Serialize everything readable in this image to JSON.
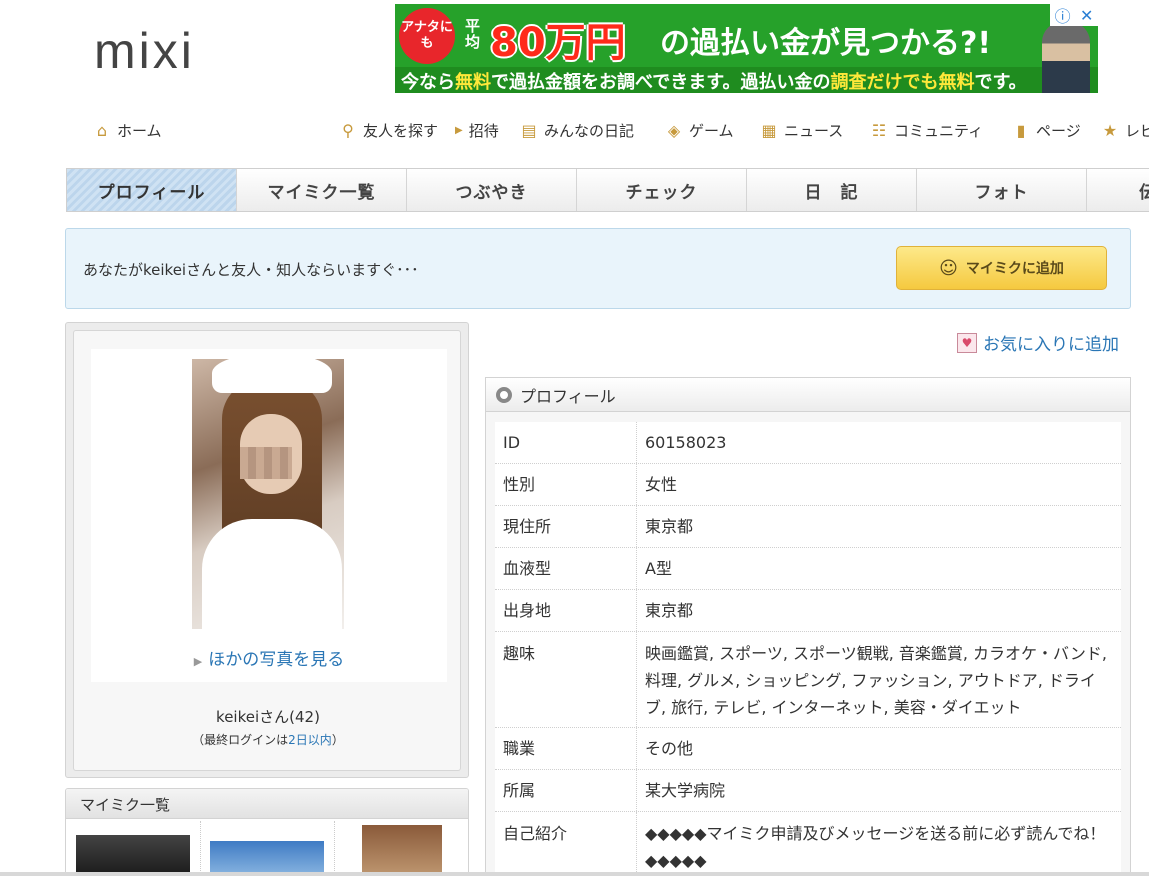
{
  "header": {
    "logo": "mixi"
  },
  "ad": {
    "badge": "アナタにも",
    "avg": "平均",
    "big": "80万円",
    "rest": "の過払い金が見つかる?!",
    "sub_a": "今なら",
    "sub_b": "無料",
    "sub_c": "で過払金額をお調べできます。過払い金の",
    "sub_d": "調査だけでも無料",
    "sub_e": "です。",
    "info_icon": "ⓘ",
    "close_icon": "✕"
  },
  "gnav": {
    "home": "ホーム",
    "find": "友人を探す",
    "invite": "招待",
    "diary": "みんなの日記",
    "game": "ゲーム",
    "news": "ニュース",
    "community": "コミュニティ",
    "page": "ページ",
    "review": "レビ"
  },
  "tabs": [
    "プロフィール",
    "マイミク一覧",
    "つぶやき",
    "チェック",
    "日　記",
    "フォト",
    "伝"
  ],
  "notice": {
    "message": "あなたがkeikeiさんと友人・知人ならいますぐ･･･",
    "add_button": "マイミクに追加"
  },
  "left": {
    "more_photos": "ほかの写真を見る",
    "user_name": "keikeiさん(42)",
    "last_login_prefix": "（最終ログインは",
    "last_login_value": "2日以内",
    "last_login_suffix": "）"
  },
  "mymixi": {
    "title": "マイミク一覧"
  },
  "right": {
    "favorite": "お気に入りに追加",
    "profile_title": "プロフィール",
    "rows": [
      {
        "key": "ID",
        "value": "60158023"
      },
      {
        "key": "性別",
        "value": "女性"
      },
      {
        "key": "現住所",
        "value": "東京都"
      },
      {
        "key": "血液型",
        "value": "A型"
      },
      {
        "key": "出身地",
        "value": "東京都"
      },
      {
        "key": "趣味",
        "value": "映画鑑賞, スポーツ, スポーツ観戦, 音楽鑑賞, カラオケ・バンド, 料理, グルメ, ショッピング, ファッション, アウトドア, ドライブ, 旅行, テレビ, インターネット, 美容・ダイエット"
      },
      {
        "key": "職業",
        "value": "その他"
      },
      {
        "key": "所属",
        "value": "某大学病院"
      },
      {
        "key": "自己紹介",
        "value": "◆◆◆◆◆マイミク申請及びメッセージを送る前に必ず読んでね！◆◆◆◆◆"
      }
    ]
  }
}
